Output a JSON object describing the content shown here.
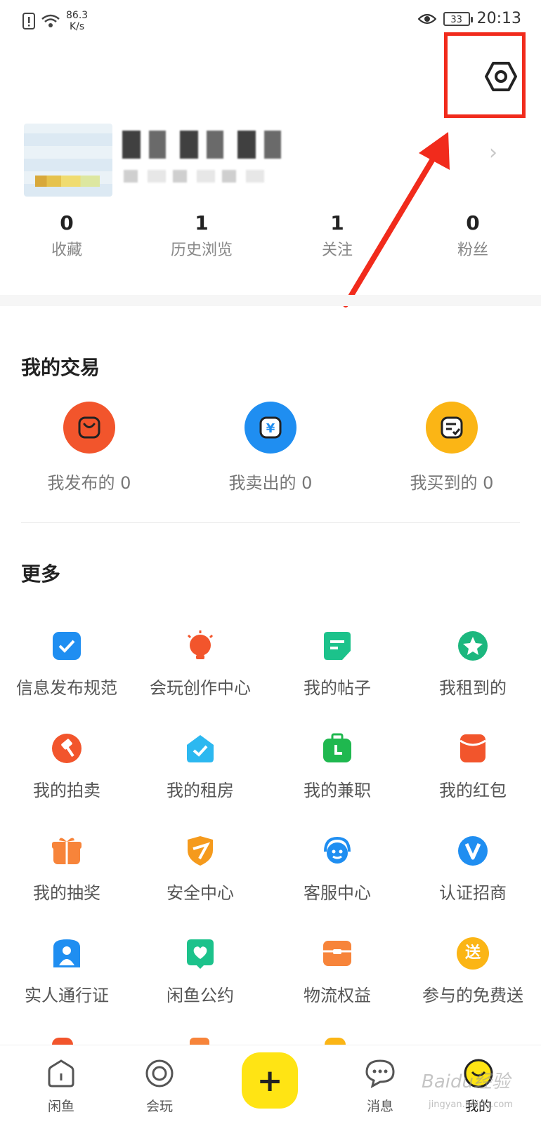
{
  "status_bar": {
    "net_speed_value": "86.3",
    "net_speed_unit": "K/s",
    "battery": "33",
    "time": "20:13"
  },
  "stats": [
    {
      "value": "0",
      "label": "收藏"
    },
    {
      "value": "1",
      "label": "历史浏览"
    },
    {
      "value": "1",
      "label": "关注"
    },
    {
      "value": "0",
      "label": "粉丝"
    }
  ],
  "trade": {
    "title": "我的交易",
    "items": [
      {
        "label": "我发布的 0",
        "color": "#f2552c",
        "icon": "bag-icon"
      },
      {
        "label": "我卖出的 0",
        "color": "#1f8ef1",
        "icon": "yen-icon"
      },
      {
        "label": "我买到的 0",
        "color": "#fbb515",
        "icon": "receipt-icon"
      }
    ]
  },
  "more": {
    "title": "更多",
    "items": [
      {
        "label": "信息发布规范",
        "icon": "check-card-icon",
        "color": "#1f8ef1"
      },
      {
        "label": "会玩创作中心",
        "icon": "lightbulb-icon",
        "color": "#f2552c"
      },
      {
        "label": "我的帖子",
        "icon": "note-icon",
        "color": "#1cc28b"
      },
      {
        "label": "我租到的",
        "icon": "star-badge-icon",
        "color": "#1cb77e"
      },
      {
        "label": "我的拍卖",
        "icon": "gavel-icon",
        "color": "#f2552c"
      },
      {
        "label": "我的租房",
        "icon": "house-check-icon",
        "color": "#2cb8f0"
      },
      {
        "label": "我的兼职",
        "icon": "briefcase-clock-icon",
        "color": "#1fb84f"
      },
      {
        "label": "我的红包",
        "icon": "red-packet-icon",
        "color": "#f2552c"
      },
      {
        "label": "我的抽奖",
        "icon": "gift-icon",
        "color": "#f7843a"
      },
      {
        "label": "安全中心",
        "icon": "shield-icon",
        "color": "#f59a1c"
      },
      {
        "label": "客服中心",
        "icon": "headset-icon",
        "color": "#1f8ef1"
      },
      {
        "label": "认证招商",
        "icon": "v-badge-icon",
        "color": "#1f8ef1"
      },
      {
        "label": "实人通行证",
        "icon": "person-shield-icon",
        "color": "#1f8ef1"
      },
      {
        "label": "闲鱼公约",
        "icon": "heart-note-icon",
        "color": "#1cc28b"
      },
      {
        "label": "物流权益",
        "icon": "package-icon",
        "color": "#f7843a"
      },
      {
        "label": "参与的免费送",
        "icon": "free-badge-icon",
        "color": "#fbb515",
        "badge_text": "送"
      }
    ]
  },
  "nav": [
    {
      "label": "闲鱼",
      "icon": "home-icon"
    },
    {
      "label": "会玩",
      "icon": "target-icon"
    },
    {
      "label": "+",
      "icon": "plus-icon"
    },
    {
      "label": "消息",
      "icon": "chat-icon"
    },
    {
      "label": "我的",
      "icon": "profile-face-icon"
    }
  ],
  "watermark": {
    "text": "Baidu经验",
    "sub": "jingyan.baidu.com"
  }
}
